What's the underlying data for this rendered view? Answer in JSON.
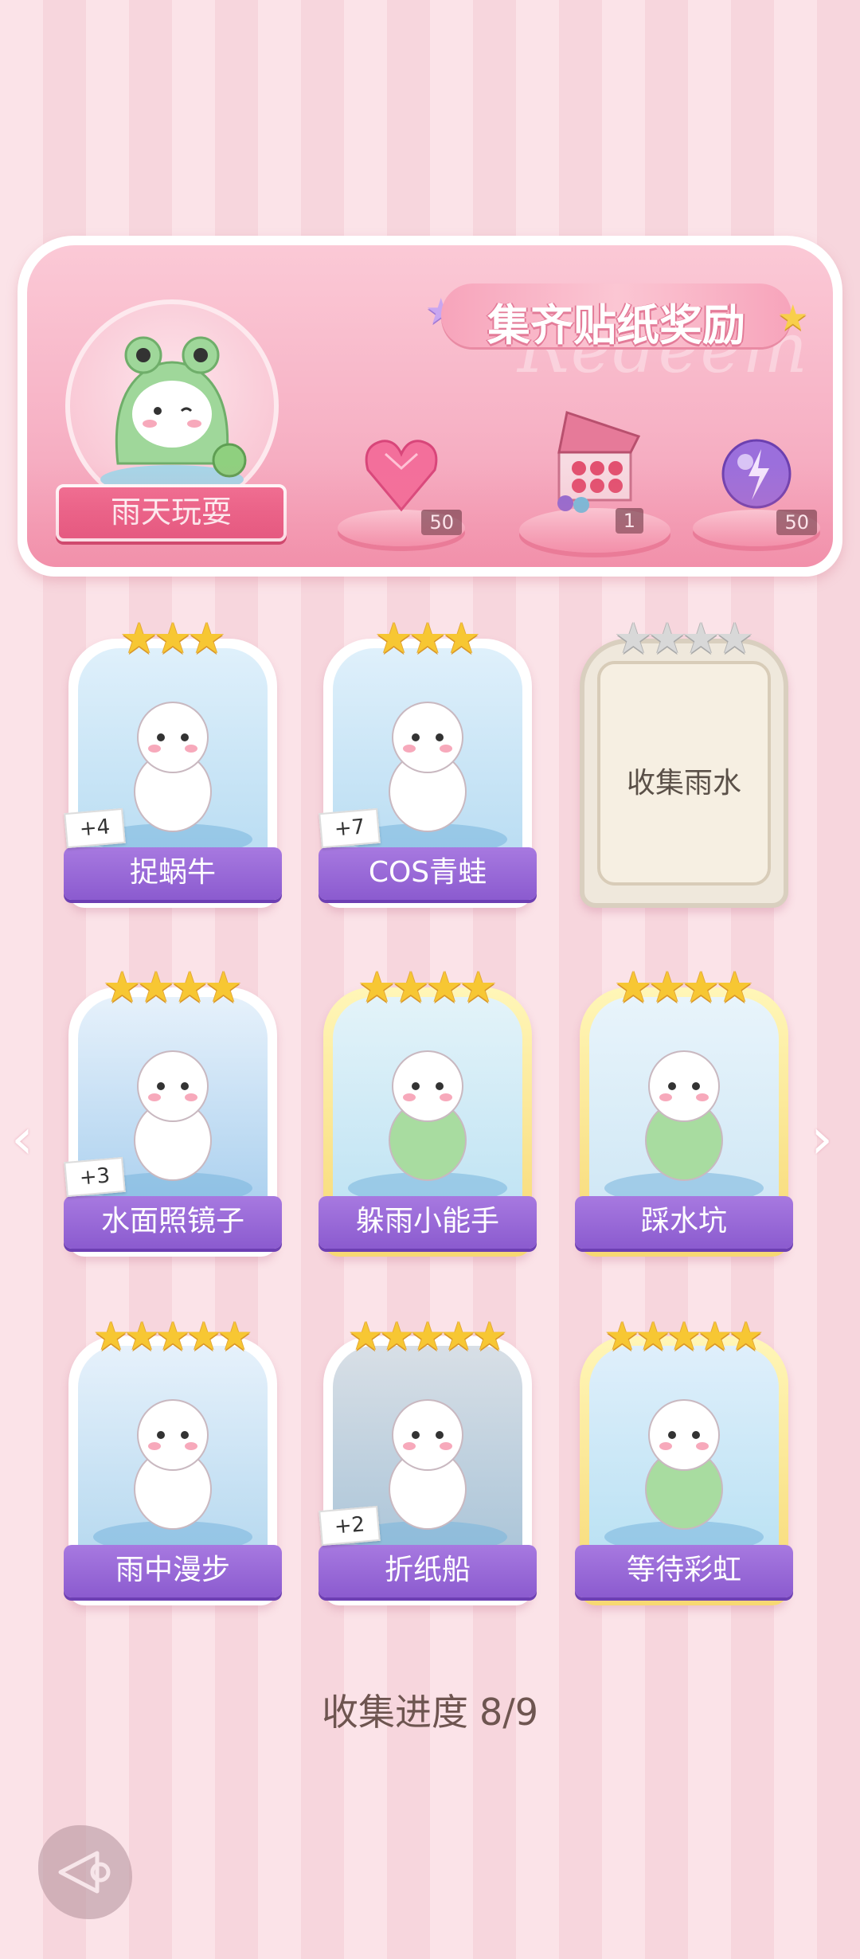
{
  "banner": {
    "title": "集齐贴纸奖励",
    "watermark": "Redeem",
    "avatar_label": "雨天玩耍",
    "rewards": [
      {
        "icon": "pink-heart-gem-icon",
        "count": "50"
      },
      {
        "icon": "gift-box-icon",
        "count": "1"
      },
      {
        "icon": "purple-energy-orb-icon",
        "count": "50"
      }
    ]
  },
  "cards": [
    {
      "label": "捉蜗牛",
      "stars": 3,
      "star_total": 3,
      "bonus": "+4",
      "collected": true
    },
    {
      "label": "COS青蛙",
      "stars": 3,
      "star_total": 3,
      "bonus": "+7",
      "collected": true
    },
    {
      "label": "收集雨水",
      "stars": 0,
      "star_total": 4,
      "collected": false
    },
    {
      "label": "水面照镜子",
      "stars": 4,
      "star_total": 4,
      "bonus": "+3",
      "collected": true
    },
    {
      "label": "躲雨小能手",
      "stars": 4,
      "star_total": 4,
      "collected": true,
      "gold": true
    },
    {
      "label": "踩水坑",
      "stars": 4,
      "star_total": 4,
      "collected": true,
      "gold": true
    },
    {
      "label": "雨中漫步",
      "stars": 5,
      "star_total": 5,
      "collected": true
    },
    {
      "label": "折纸船",
      "stars": 5,
      "star_total": 5,
      "bonus": "+2",
      "collected": true
    },
    {
      "label": "等待彩虹",
      "stars": 5,
      "star_total": 5,
      "collected": true,
      "gold": true
    }
  ],
  "progress": {
    "label": "收集进度",
    "value": "8/9"
  },
  "colors": {
    "label_purple": "#8b5bcf",
    "star_gold": "#f7c733",
    "banner_pink": "#f7b3c6"
  }
}
